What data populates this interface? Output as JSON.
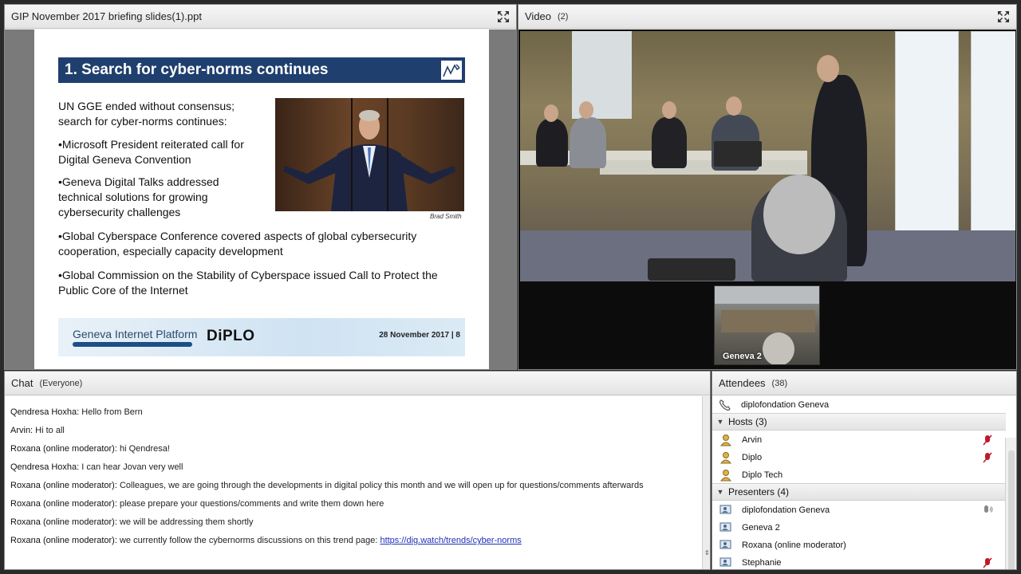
{
  "share": {
    "title": "GIP November 2017 briefing slides(1).ppt",
    "slide": {
      "heading": "1. Search for cyber-norms continues",
      "intro_line1": "UN GGE ended without consensus;",
      "intro_line2": "search for cyber-norms continues:",
      "bullet1_line1": "•Microsoft President reiterated call for",
      "bullet1_line2": "Digital Geneva Convention",
      "bullet2_line1": "•Geneva Digital Talks addressed",
      "bullet2_line2": "technical solutions for growing",
      "bullet2_line3": "cybersecurity challenges",
      "bullet3_line1": "•Global Cyberspace Conference covered aspects of global cybersecurity",
      "bullet3_line2": "cooperation, especially capacity development",
      "bullet4_line1": "•Global Commission on the Stability of Cyberspace issued Call to Protect the",
      "bullet4_line2": "Public Core of the Internet",
      "photo_caption": "Brad Smith",
      "footer_platform": "Geneva Internet Platform",
      "footer_logo": "DiPLO",
      "footer_date": "28 November 2017   |   8"
    }
  },
  "video": {
    "title": "Video",
    "count": "(2)",
    "thumb_label": "Geneva 2"
  },
  "chat": {
    "title": "Chat",
    "scope": "(Everyone)",
    "messages": [
      {
        "who": "Qendresa Hoxha:",
        "text": " Hello from Bern"
      },
      {
        "who": "Arvin:",
        "text": " Hi to all"
      },
      {
        "who": "Roxana (online moderator):",
        "text": " hi Qendresa!"
      },
      {
        "who": "Qendresa Hoxha:",
        "text": " I can hear Jovan very well"
      },
      {
        "who": "Roxana (online moderator):",
        "text": " Colleagues, we are going through the developments in digital policy this month and we will open up for questions/comments afterwards"
      },
      {
        "who": "Roxana (online moderator):",
        "text": " please prepare your questions/comments and write them down here"
      },
      {
        "who": "Roxana (online moderator):",
        "text": " we will be addressing them shortly"
      },
      {
        "who": "Roxana (online moderator):",
        "text": " we currently follow the cybernorms discussions on this trend page: ",
        "link": "https://dig.watch/trends/cyber-norms"
      }
    ]
  },
  "attendees": {
    "title": "Attendees",
    "count": "(38)",
    "top_user": "diplofondation Geneva",
    "hosts_label": "Hosts (3)",
    "hosts": [
      "Arvin",
      "Diplo",
      "Diplo Tech"
    ],
    "presenters_label": "Presenters (4)",
    "presenters": [
      "diplofondation Geneva",
      "Geneva 2",
      "Roxana (online moderator)",
      "Stephanie"
    ]
  },
  "colors": {
    "slide_title_bg": "#1f3f6e",
    "link": "#1f2fb8",
    "mic_red": "#c0182a"
  }
}
